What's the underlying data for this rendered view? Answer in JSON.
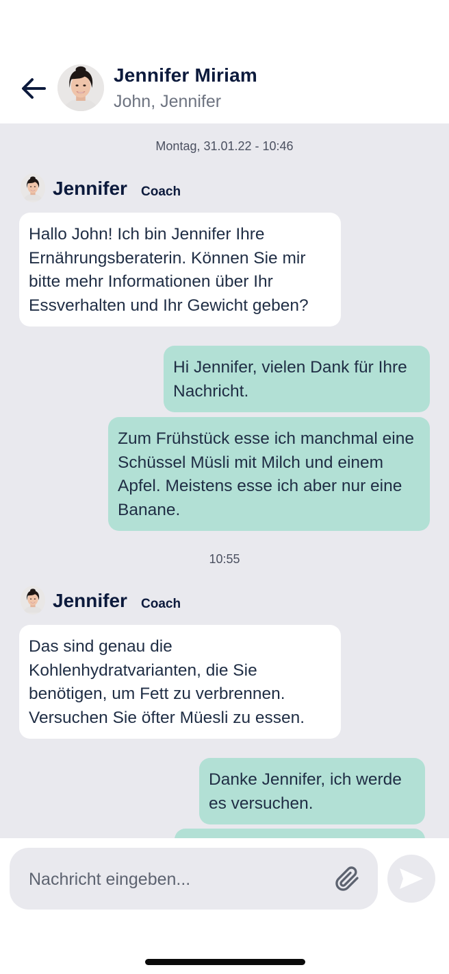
{
  "header": {
    "back_icon": "arrow-left-icon",
    "avatar_icon": "avatar-jennifer",
    "title": "Jennifer Miriam",
    "members": "John, Jennifer"
  },
  "chat": {
    "timestamp_1": "Montag, 31.01.22 - 10:46",
    "sender_1": {
      "name": "Jennifer",
      "role": "Coach"
    },
    "msg_1": "Hallo John! Ich bin Jennifer Ihre Ernährungsberaterin. Können Sie mir bitte mehr Informationen über Ihr Essverhalten und Ihr Gewicht geben?",
    "msg_2": "Hi Jennifer, vielen Dank für Ihre Nachricht.",
    "msg_3": "Zum Frühstück esse ich manchmal eine Schüssel Müsli mit Milch und einem Apfel. Meistens esse ich aber nur eine Banane.",
    "timestamp_2": "10:55",
    "sender_2": {
      "name": "Jennifer",
      "role": "Coach"
    },
    "msg_4": "Das sind genau die Kohlenhydratvarianten, die Sie benötigen, um Fett zu verbrennen. Versuchen Sie öfter Müesli zu essen.",
    "msg_5": "Danke Jennifer, ich werde es versuchen."
  },
  "composer": {
    "placeholder": "Nachricht eingeben...",
    "attach_icon": "paperclip-icon",
    "send_icon": "send-icon"
  },
  "colors": {
    "chat_background": "#e9e9ee",
    "incoming_bubble": "#ffffff",
    "outgoing_bubble": "#b2e0d5",
    "name_text": "#0c1a3c"
  }
}
